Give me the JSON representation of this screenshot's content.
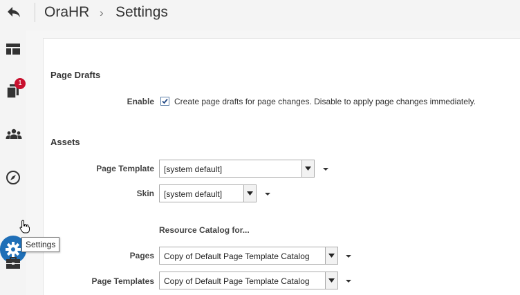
{
  "header": {
    "app_name": "OraHR",
    "separator": "›",
    "page_title": "Settings"
  },
  "sidebar": {
    "notification_count": "1",
    "active_item": "settings",
    "tooltip": "Settings"
  },
  "page_drafts": {
    "title": "Page Drafts",
    "enable_label": "Enable",
    "enable_checked": true,
    "enable_description": "Create page drafts for page changes. Disable to apply page changes immediately."
  },
  "assets": {
    "title": "Assets",
    "page_template_label": "Page Template",
    "page_template_value": "[system default]",
    "skin_label": "Skin",
    "skin_value": "[system default]",
    "resource_catalog_heading": "Resource Catalog for...",
    "pages_label": "Pages",
    "pages_value": "Copy of Default Page Template Catalog",
    "page_templates_label": "Page Templates",
    "page_templates_value": "Copy of Default Page Template Catalog"
  },
  "colors": {
    "accent": "#1f6fb7",
    "badge": "#c8102e",
    "sidebar_bg": "#f4f4f4"
  }
}
